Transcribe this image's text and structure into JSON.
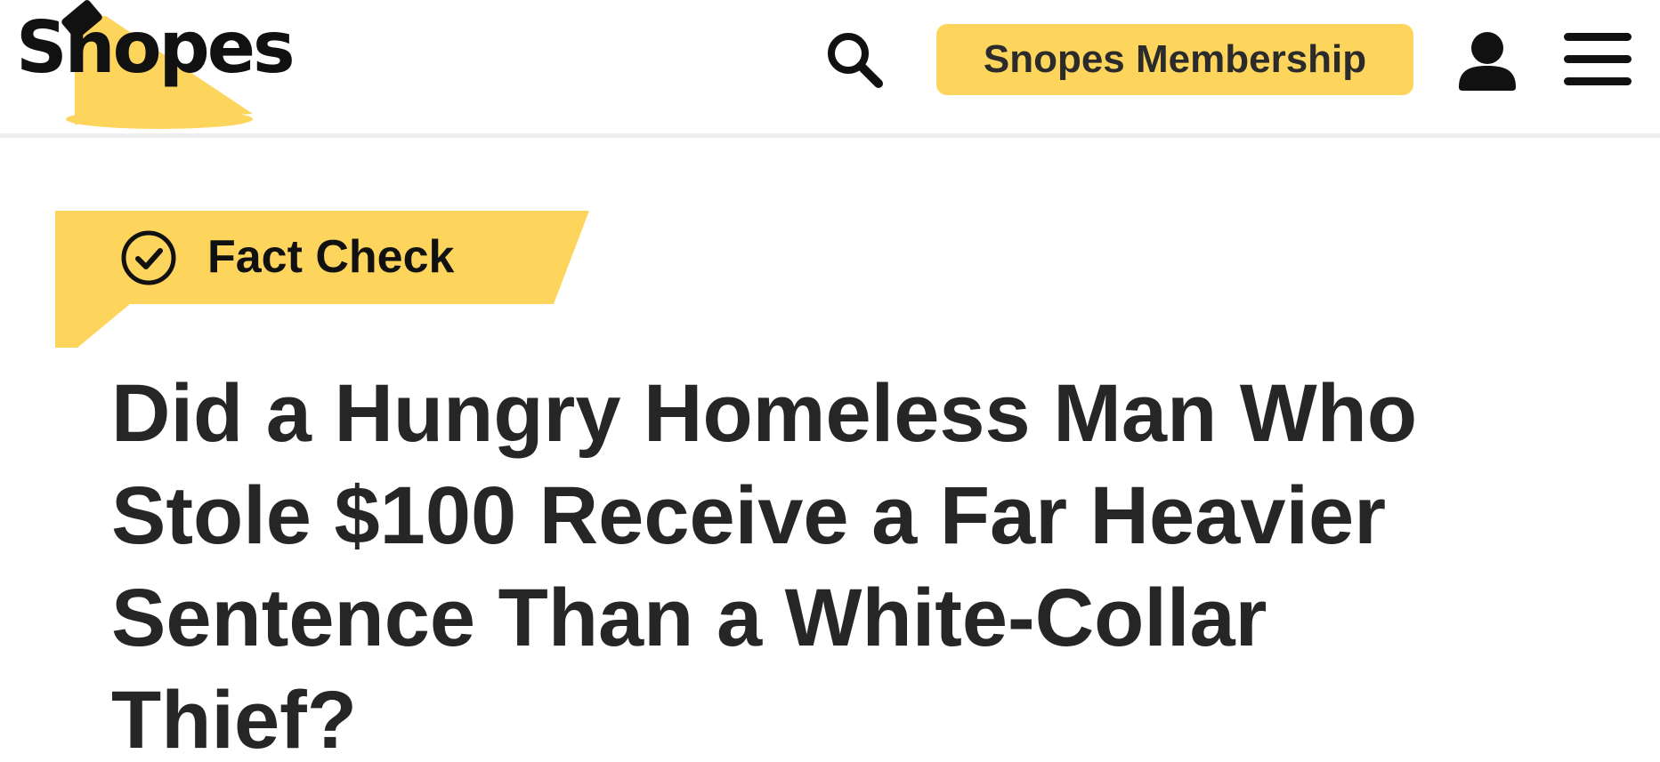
{
  "header": {
    "logo_text": "Snopes",
    "membership_label": "Snopes Membership",
    "accent_color": "#fdd55c"
  },
  "icons": {
    "search": "search-icon",
    "account": "user-icon",
    "menu": "hamburger-menu-icon",
    "fact_check": "check-circle-icon"
  },
  "article": {
    "category": "Fact Check",
    "title_lines": [
      "Did a Hungry Homeless Man Who",
      "Stole $100 Receive a Far Heavier",
      "Sentence Than a White-Collar",
      "Thief?"
    ]
  }
}
